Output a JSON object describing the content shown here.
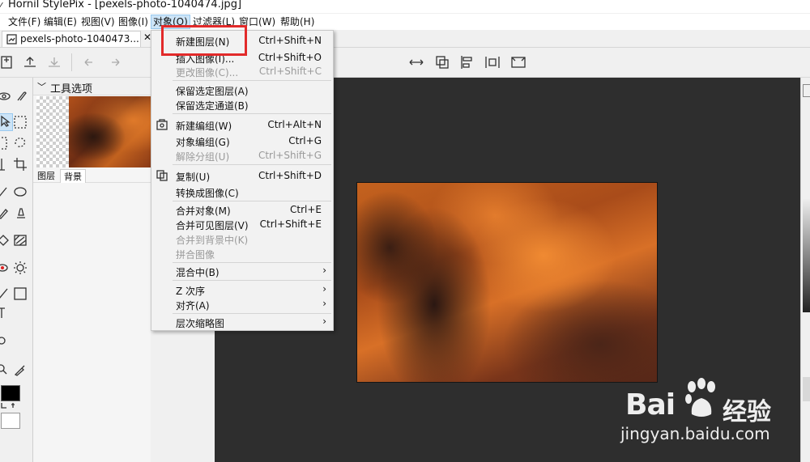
{
  "window": {
    "title": "Hornil StylePix - [pexels-photo-1040474.jpg]"
  },
  "menubar": {
    "items": [
      {
        "label": "文件(F)"
      },
      {
        "label": "编辑(E)"
      },
      {
        "label": "视图(V)"
      },
      {
        "label": "图像(I)"
      },
      {
        "label": "对象(O)"
      },
      {
        "label": "过滤器(L)"
      },
      {
        "label": "窗口(W)"
      },
      {
        "label": "帮助(H)"
      }
    ],
    "active_index": 4
  },
  "tabs": {
    "document": "pexels-photo-1040473..."
  },
  "tool_panel": {
    "title": "工具选项",
    "thumb_tabs": [
      "图层",
      "背景"
    ],
    "fg_color": "#000000",
    "bg_color": "#ffffff"
  },
  "object_menu": {
    "items": [
      {
        "label": "新建图层(N)",
        "shortcut": "Ctrl+Shift+N",
        "disabled": false
      },
      {
        "label": "插入图像(I)...",
        "shortcut": "Ctrl+Shift+O",
        "disabled": false
      },
      {
        "label": "更改图像(C)...",
        "shortcut": "Ctrl+Shift+C",
        "disabled": true
      },
      {
        "label": "保留选定图层(A)",
        "shortcut": "",
        "disabled": false
      },
      {
        "label": "保留选定通道(B)",
        "shortcut": "",
        "disabled": false
      },
      {
        "label": "新建编组(W)",
        "shortcut": "Ctrl+Alt+N",
        "disabled": false
      },
      {
        "label": "对象编组(G)",
        "shortcut": "Ctrl+G",
        "disabled": false
      },
      {
        "label": "解除分组(U)",
        "shortcut": "Ctrl+Shift+G",
        "disabled": true
      },
      {
        "label": "复制(U)",
        "shortcut": "Ctrl+Shift+D",
        "disabled": false
      },
      {
        "label": "转换成图像(C)",
        "shortcut": "",
        "disabled": false
      },
      {
        "label": "合并对象(M)",
        "shortcut": "Ctrl+E",
        "disabled": false
      },
      {
        "label": "合并可见图层(V)",
        "shortcut": "Ctrl+Shift+E",
        "disabled": false
      },
      {
        "label": "合并到背景中(K)",
        "shortcut": "",
        "disabled": true
      },
      {
        "label": "拼合图像",
        "shortcut": "",
        "disabled": true
      },
      {
        "label": "混合中(B)",
        "shortcut": "",
        "disabled": false
      },
      {
        "label": "Z 次序",
        "shortcut": "",
        "disabled": false
      },
      {
        "label": "对齐(A)",
        "shortcut": "",
        "disabled": false
      },
      {
        "label": "层次缩略图",
        "shortcut": "",
        "disabled": false
      }
    ]
  },
  "watermark": {
    "brand_left": "Bai",
    "brand_right": "经验",
    "url": "jingyan.baidu.com"
  },
  "colors": {
    "highlight": "#e22a2a",
    "workspace": "#2e2e2e",
    "menu_active": "#cce4f7"
  }
}
